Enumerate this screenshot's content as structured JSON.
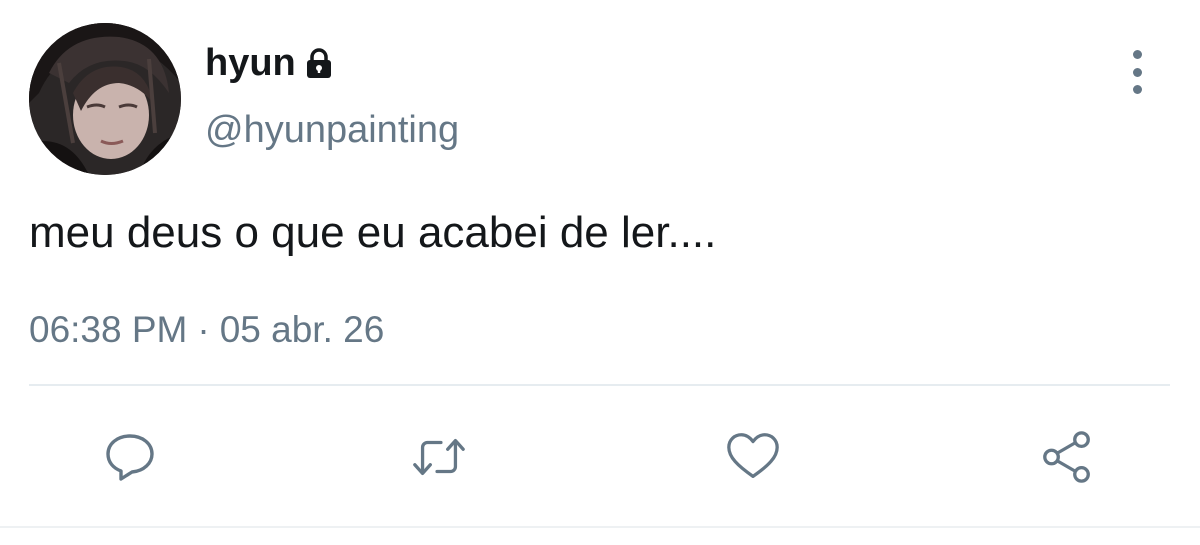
{
  "tweet": {
    "author": {
      "display_name": "hyun",
      "handle": "@hyunpainting",
      "protected_icon": "lock-icon",
      "avatar": "profile-photo"
    },
    "text": "meu deus o que eu acabei de ler....",
    "time": "06:38 PM",
    "separator": "·",
    "date": "05 abr. 26"
  },
  "actions": [
    {
      "name": "reply",
      "icon": "reply-icon"
    },
    {
      "name": "retweet",
      "icon": "retweet-icon"
    },
    {
      "name": "like",
      "icon": "heart-icon"
    },
    {
      "name": "share",
      "icon": "share-icon"
    }
  ],
  "menu": {
    "icon": "more-vertical-icon"
  },
  "colors": {
    "text": "#14171a",
    "secondary": "#657786",
    "divider": "#e6ecf0",
    "background": "#ffffff"
  }
}
